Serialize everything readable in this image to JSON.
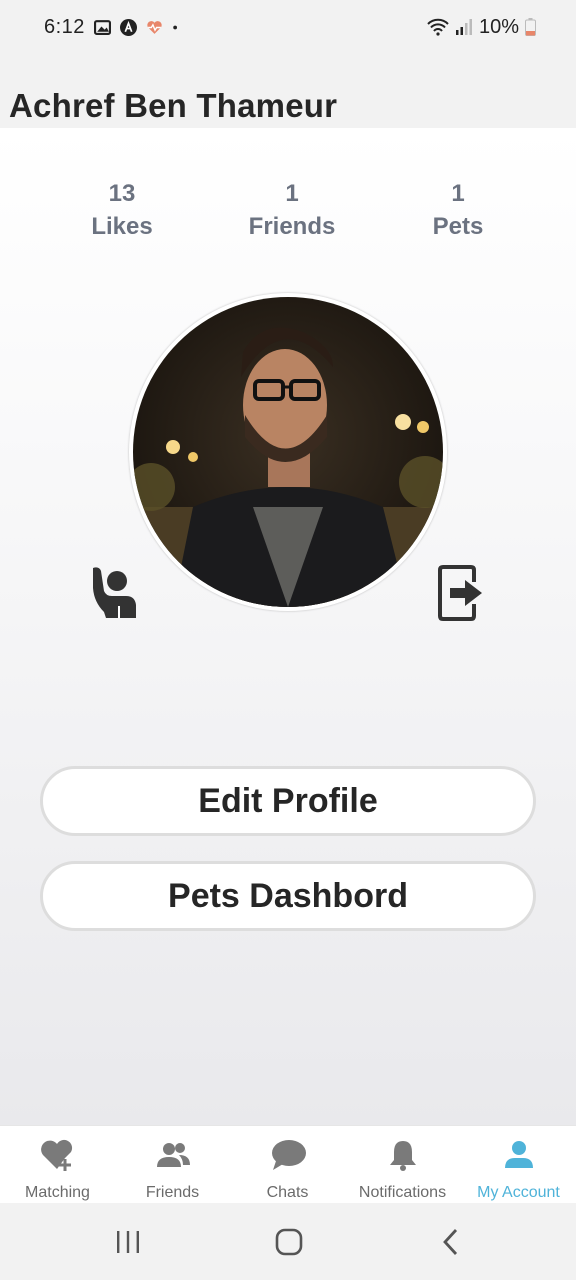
{
  "status_bar": {
    "time": "6:12",
    "battery": "10%",
    "icons": [
      "image-icon",
      "a-badge-icon",
      "heart-pulse-icon",
      "dot-icon",
      "wifi-icon",
      "signal-icon",
      "battery-icon"
    ]
  },
  "header": {
    "title": "Achref Ben Thameur"
  },
  "stats": [
    {
      "value": "13",
      "label": "Likes"
    },
    {
      "value": "1",
      "label": "Friends"
    },
    {
      "value": "1",
      "label": "Pets"
    }
  ],
  "actions": {
    "edit_profile": "Edit Profile",
    "pets_dashboard": "Pets Dashbord"
  },
  "bottom_nav": {
    "items": [
      {
        "label": "Matching",
        "icon": "heart-plus-icon"
      },
      {
        "label": "Friends",
        "icon": "users-icon"
      },
      {
        "label": "Chats",
        "icon": "chat-bubble-icon"
      },
      {
        "label": "Notifications",
        "icon": "bell-icon"
      },
      {
        "label": "My Account",
        "icon": "user-icon",
        "active": true
      }
    ],
    "active_color": "#4fb3d9",
    "inactive_color": "#6b6b6b"
  },
  "colors": {
    "stats_text": "#6b7280",
    "title_text": "#262626",
    "button_border": "#dddddd"
  }
}
